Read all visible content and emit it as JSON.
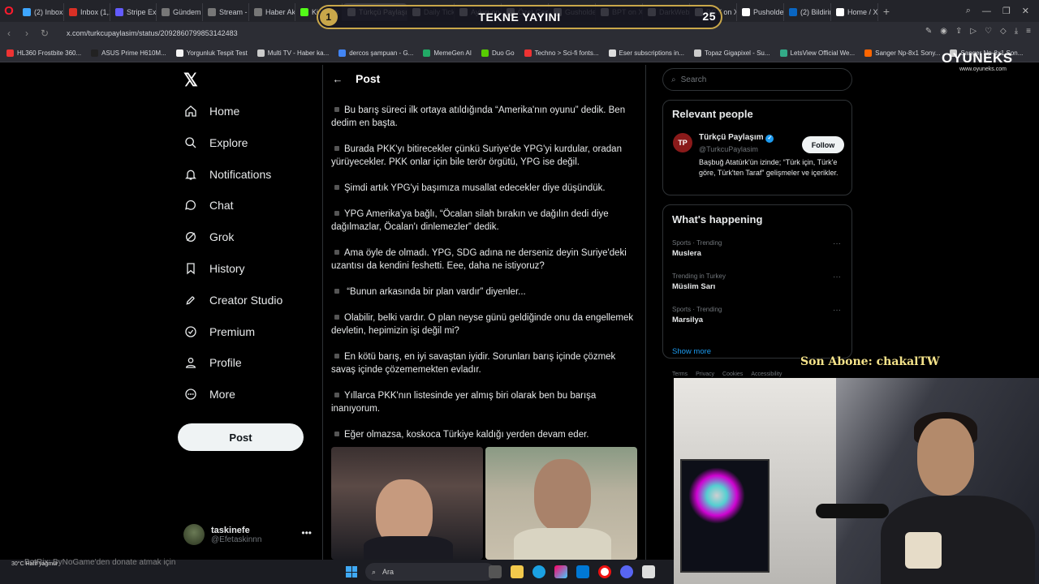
{
  "browser": {
    "tabs": [
      {
        "label": "(2) Inbox",
        "color": "#3ea6ff"
      },
      {
        "label": "Inbox (1,13",
        "color": "#d93025"
      },
      {
        "label": "Stripe Expr",
        "color": "#635bff"
      },
      {
        "label": "Gündem M",
        "color": "#777777"
      },
      {
        "label": "Stream - K",
        "color": "#777777"
      },
      {
        "label": "Haber Akı",
        "color": "#777777"
      },
      {
        "label": "KickLink",
        "color": "#53fc18"
      },
      {
        "label": "Türkçü Paylaşım",
        "color": "#ffffff"
      },
      {
        "label": "Daily Tick",
        "color": "#ffffff"
      },
      {
        "label": "Aykırı on",
        "color": "#ffffff"
      },
      {
        "label": "Özet Geç",
        "color": "#ffffff"
      },
      {
        "label": "Gusholder",
        "color": "#ffffff"
      },
      {
        "label": "BPT on X:",
        "color": "#ffffff"
      },
      {
        "label": "DarkWeb",
        "color": "#ffffff"
      },
      {
        "label": "BGY on X:",
        "color": "#ffffff"
      },
      {
        "label": "Pusholder",
        "color": "#ffffff"
      },
      {
        "label": "(2) Bildirim",
        "color": "#0a66c2"
      },
      {
        "label": "Home / X",
        "color": "#ffffff"
      }
    ],
    "url": "x.com/turkcupaylasim/status/2092860799853142483",
    "bookmarks": [
      {
        "label": "HL360 Frostbite 360...",
        "color": "#e33"
      },
      {
        "label": "ASUS Prime H610M...",
        "color": "#222"
      },
      {
        "label": "Yorgunluk Tespit Test",
        "color": "#f5f5f5"
      },
      {
        "label": "Multi TV - Haber ka...",
        "color": "#ccc"
      },
      {
        "label": "dercos şampuan - G...",
        "color": "#4285f4"
      },
      {
        "label": "MemeGen AI",
        "color": "#2a6"
      },
      {
        "label": "Duo Go",
        "color": "#58cc02"
      },
      {
        "label": "Techno > Sci-fi fonts...",
        "color": "#e33"
      },
      {
        "label": "Eser subscriptions in...",
        "color": "#ddd"
      },
      {
        "label": "Topaz Gigapixel - Su...",
        "color": "#ccc"
      },
      {
        "label": "LetsView Official We...",
        "color": "#3a8"
      },
      {
        "label": "Sanger Np-8x1 Sony...",
        "color": "#f60"
      },
      {
        "label": "Sanger Np-8x1 Son...",
        "color": "#ccc"
      }
    ]
  },
  "overlay": {
    "title": "TEKNE YAYINI",
    "left_num": "1",
    "right_num": "25",
    "brand": "OYUNEKS",
    "brand_sub": "www.oyuneks.com",
    "subscriber": "Son Abone: chakalTW",
    "chat_line": "BotRix: ByNoGame'den donate atmak için",
    "weather": "30°C Hafif yağmur"
  },
  "nav": {
    "items": [
      {
        "label": "Home",
        "icon": "home-icon"
      },
      {
        "label": "Explore",
        "icon": "search-icon"
      },
      {
        "label": "Notifications",
        "icon": "bell-icon"
      },
      {
        "label": "Chat",
        "icon": "chat-icon"
      },
      {
        "label": "Grok",
        "icon": "grok-icon"
      },
      {
        "label": "History",
        "icon": "bookmark-icon"
      },
      {
        "label": "Creator Studio",
        "icon": "rocket-icon"
      },
      {
        "label": "Premium",
        "icon": "badge-icon"
      },
      {
        "label": "Profile",
        "icon": "person-icon"
      },
      {
        "label": "More",
        "icon": "more-circle-icon"
      }
    ],
    "post_label": "Post",
    "account_name": "taskinefe",
    "account_handle": "@Efetaskinnn"
  },
  "main": {
    "title": "Post",
    "paragraphs": [
      "Bu barış süreci ilk ortaya atıldığında “Amerika'nın oyunu” dedik. Ben dedim en başta.",
      "Burada PKK'yı bitirecekler çünkü Suriye'de YPG'yi kurdular, oradan yürüyecekler. PKK onlar için bile terör örgütü, YPG ise değil.",
      "Şimdi artık YPG'yi başımıza musallat edecekler diye düşündük.",
      "YPG Amerika'ya bağlı, “Öcalan silah bırakın ve dağılın dedi diye dağılmazlar, Öcalan'ı dinlemezler” dedik.",
      "Ama öyle de olmadı. YPG, SDG adına ne derseniz deyin Suriye'deki uzantısı da kendini feshetti. Eee, daha ne istiyoruz?",
      " “Bunun arkasında bir plan vardır” diyenler...",
      "Olabilir, belki vardır. O plan neyse günü geldiğinde onu da engellemek devletin, hepimizin işi değil mi?",
      "En kötü barış, en iyi savaştan iyidir. Sorunları barış içinde çözmek savaş içinde çözememekten evladır.",
      "Yıllarca PKK'nın listesinde yer almış biri olarak ben bu barışa inanıyorum.",
      "Eğer olmazsa, koskoca Türkiye kaldığı yerden devam eder."
    ]
  },
  "right": {
    "search_placeholder": "Search",
    "relevant_title": "Relevant people",
    "person_name": "Türkçü Paylaşım",
    "person_handle": "@TurkcuPaylasim",
    "follow_label": "Follow",
    "person_bio": "Başbuğ Atatürk'ün izinde; “Türk için, Türk'e göre, Türk'ten Taraf” gelişmeler ve içerikler.",
    "happening_title": "What's happening",
    "trends": [
      {
        "meta": "Sports · Trending",
        "name": "Muslera"
      },
      {
        "meta": "Trending in Turkey",
        "name": "Müslim Sarı"
      },
      {
        "meta": "Sports · Trending",
        "name": "Marsilya"
      }
    ],
    "show_more": "Show more",
    "footer": [
      "Terms",
      "Privacy",
      "Cookies",
      "Accessibility"
    ]
  },
  "taskbar": {
    "search_placeholder": "Ara"
  }
}
